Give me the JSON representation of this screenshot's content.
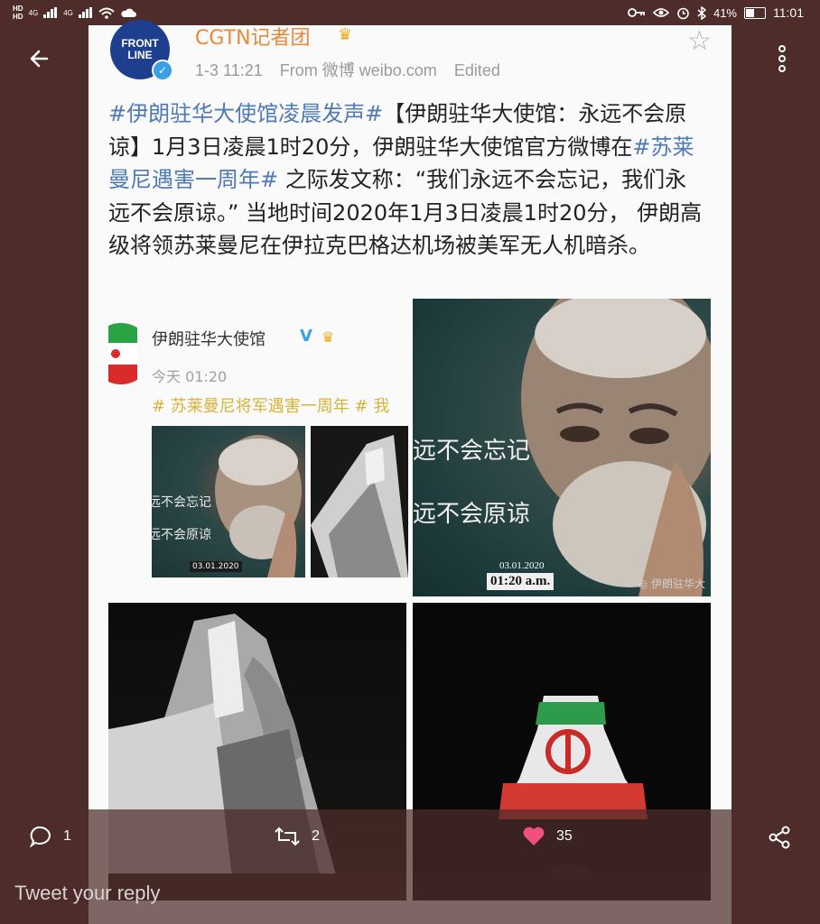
{
  "status_bar": {
    "hd1": "HD",
    "hd2": "HD",
    "net1": "4G",
    "net2": "4G",
    "battery_percent": "41%",
    "battery_level": 0.41,
    "time": "11:01"
  },
  "post": {
    "author": "CGTN记者团",
    "avatar_text_line1": "FRONT",
    "avatar_text_line2": "LINE",
    "date": "1-3 11:21",
    "source": "From 微博 weibo.com",
    "edited": "Edited",
    "text_segments": [
      {
        "text": "#伊朗驻华大使馆凌晨发声#",
        "hashtag": true
      },
      {
        "text": "【伊朗驻华大使馆：永远不会原谅】1月3日凌晨1时20分，伊朗驻华大使馆官方微博在",
        "hashtag": false
      },
      {
        "text": "#苏莱曼尼遇害一周年#",
        "hashtag": true
      },
      {
        "text": " 之际发文称：“我们永远不会忘记，我们永远不会原谅。” 当地时间2020年1月3日凌晨1时20分， 伊朗高级将领苏莱曼尼在伊拉克巴格达机场被美军无人机暗杀。",
        "hashtag": false
      }
    ]
  },
  "images": {
    "screenshot": {
      "account_name": "伊朗驻华大使馆",
      "verified_mark": "V",
      "time": "今天 01:20",
      "hashtag": "# 苏莱曼尼将军遇害一周年 # 我",
      "thumb_line1": "远不会忘记",
      "thumb_line2": "远不会原谅",
      "thumb_date": "03.01.2020"
    },
    "portrait": {
      "line1": "远不会忘记",
      "line2": "远不会原谅",
      "date": "03.01.2020",
      "time": "01:20 a.m.",
      "watermark": "伊朗驻华大"
    }
  },
  "actions": {
    "reply_count": "1",
    "retweet_count": "2",
    "like_count": "35",
    "reply_placeholder": "Tweet your reply"
  },
  "colors": {
    "background": "#4e2c2a",
    "hashtag": "#4f7ab8",
    "author": "#e7893a",
    "like": "#f0507a"
  }
}
